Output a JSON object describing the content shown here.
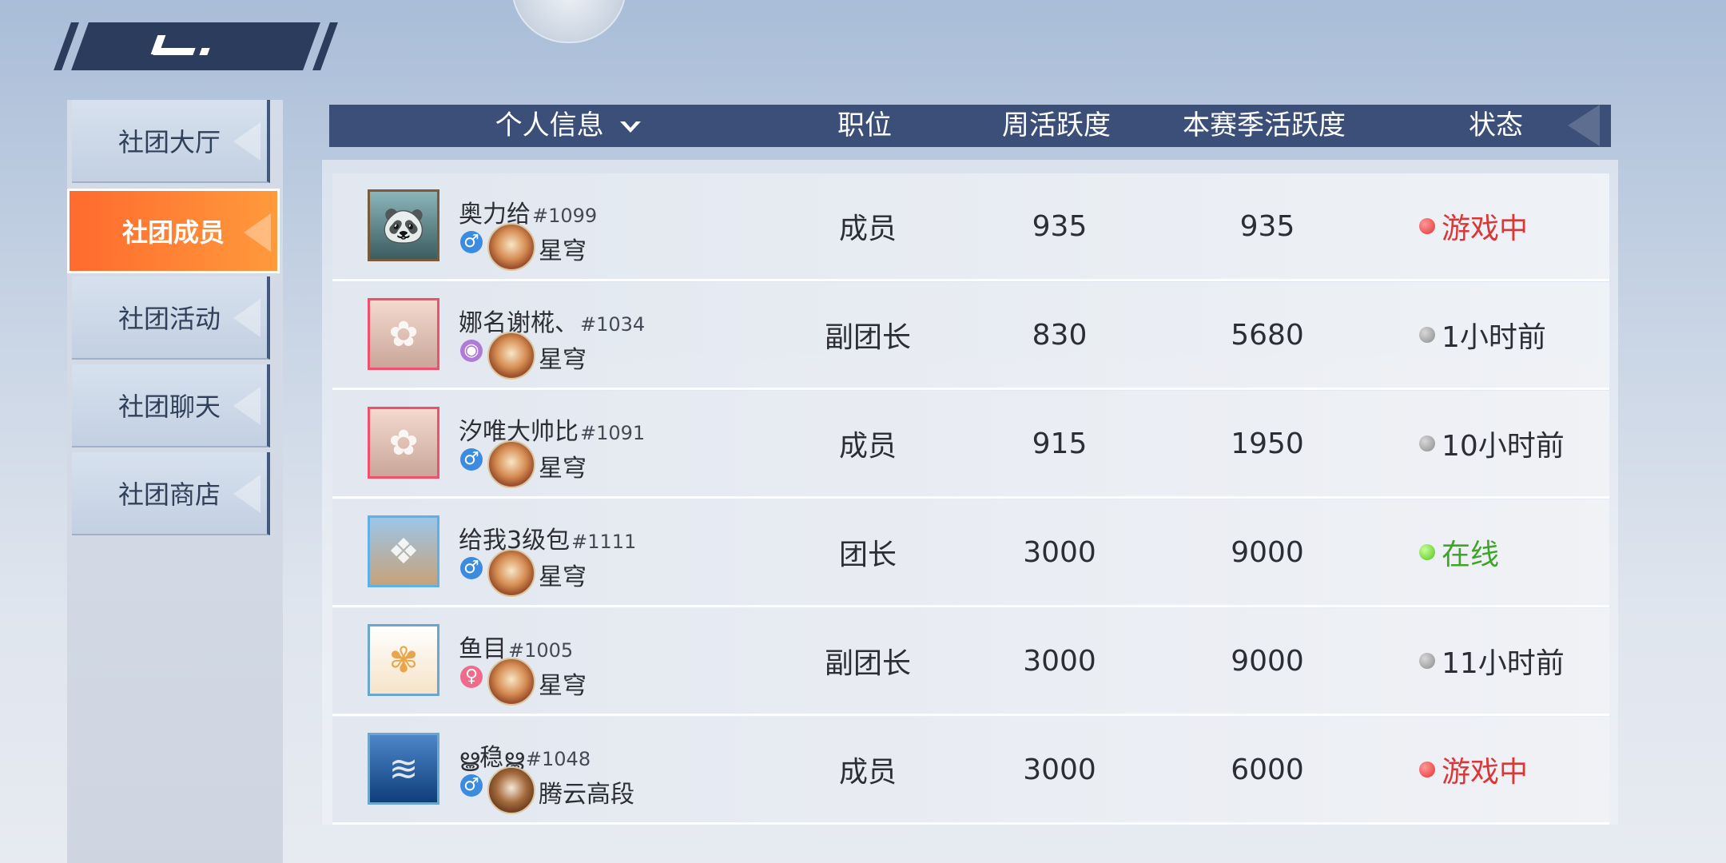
{
  "sidebar": {
    "items": [
      {
        "label": "社团大厅"
      },
      {
        "label": "社团成员"
      },
      {
        "label": "社团活动"
      },
      {
        "label": "社团聊天"
      },
      {
        "label": "社团商店"
      }
    ],
    "active_index": 1
  },
  "table": {
    "headers": {
      "info": "个人信息",
      "position": "职位",
      "weekly": "周活跃度",
      "season": "本赛季活跃度",
      "status": "状态"
    },
    "rows": [
      {
        "name": "奥力给",
        "id": "#1099",
        "gender": "male",
        "gender_icon": "♂",
        "rank": "星穹",
        "position": "成员",
        "weekly": "935",
        "season": "935",
        "status": "游戏中",
        "status_color": "red"
      },
      {
        "name": "娜名谢椛、",
        "id": "#1034",
        "gender": "hidden",
        "gender_icon": "◉",
        "rank": "星穹",
        "position": "副团长",
        "weekly": "830",
        "season": "5680",
        "status": "1小时前",
        "status_color": "gray"
      },
      {
        "name": "汐唯大帅比",
        "id": "#1091",
        "gender": "male",
        "gender_icon": "♂",
        "rank": "星穹",
        "position": "成员",
        "weekly": "915",
        "season": "1950",
        "status": "10小时前",
        "status_color": "gray"
      },
      {
        "name": "给我3级包",
        "id": "#1111",
        "gender": "male",
        "gender_icon": "♂",
        "rank": "星穹",
        "position": "团长",
        "weekly": "3000",
        "season": "9000",
        "status": "在线",
        "status_color": "green"
      },
      {
        "name": "鱼目",
        "id": "#1005",
        "gender": "female",
        "gender_icon": "♀",
        "rank": "星穹",
        "position": "副团长",
        "weekly": "3000",
        "season": "9000",
        "status": "11小时前",
        "status_color": "gray"
      },
      {
        "name": "ൠ稳ൠ",
        "id": "#1048",
        "gender": "male",
        "gender_icon": "♂",
        "rank": "腾云高段",
        "position": "成员",
        "weekly": "3000",
        "season": "6000",
        "status": "游戏中",
        "status_color": "red"
      }
    ]
  },
  "colors": {
    "header_bg": "#3b4f78",
    "active_tab": "#ff7a30",
    "status_red": "#d93838",
    "status_green": "#3fa52a"
  }
}
